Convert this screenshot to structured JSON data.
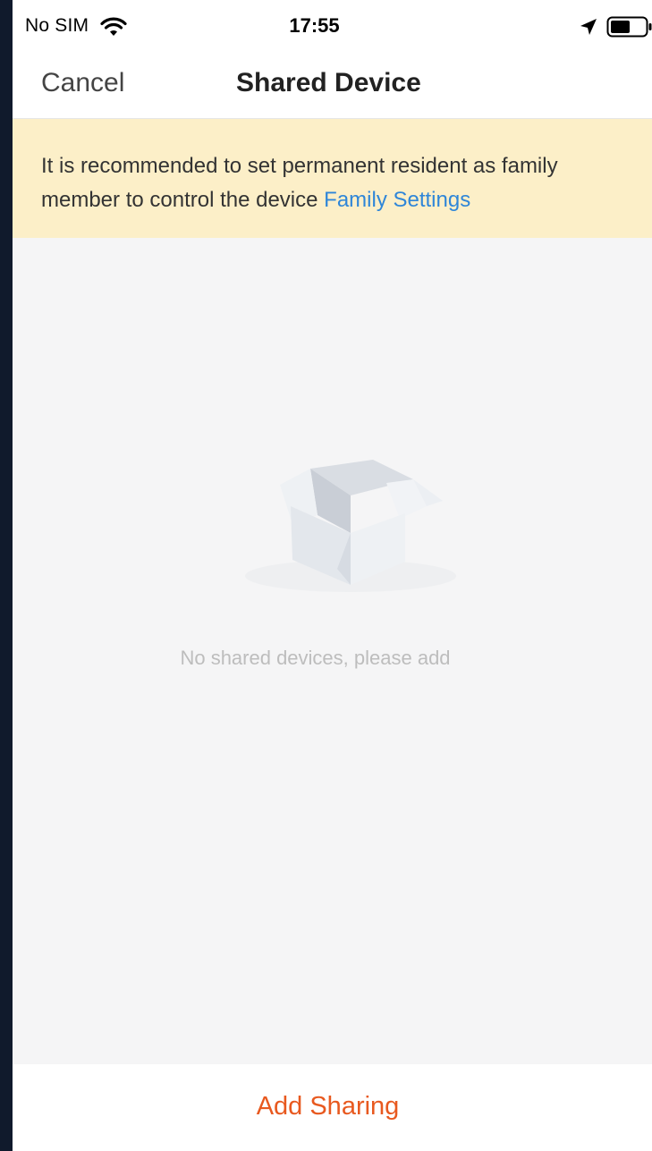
{
  "status_bar": {
    "carrier": "No SIM",
    "time": "17:55",
    "icons": [
      "wifi-icon",
      "location-arrow-icon",
      "battery-icon"
    ]
  },
  "nav": {
    "cancel_label": "Cancel",
    "title": "Shared Device"
  },
  "banner": {
    "text": "It is recommended to set permanent resident as family member to control the device",
    "link_label": "Family Settings"
  },
  "empty_state": {
    "icon": "empty-box-icon",
    "message": "No shared devices, please add"
  },
  "footer": {
    "action_label": "Add Sharing"
  },
  "colors": {
    "accent": "#e8591f",
    "link": "#2f86d8",
    "banner_bg": "#fcefc8",
    "page_bg": "#f5f5f6"
  }
}
